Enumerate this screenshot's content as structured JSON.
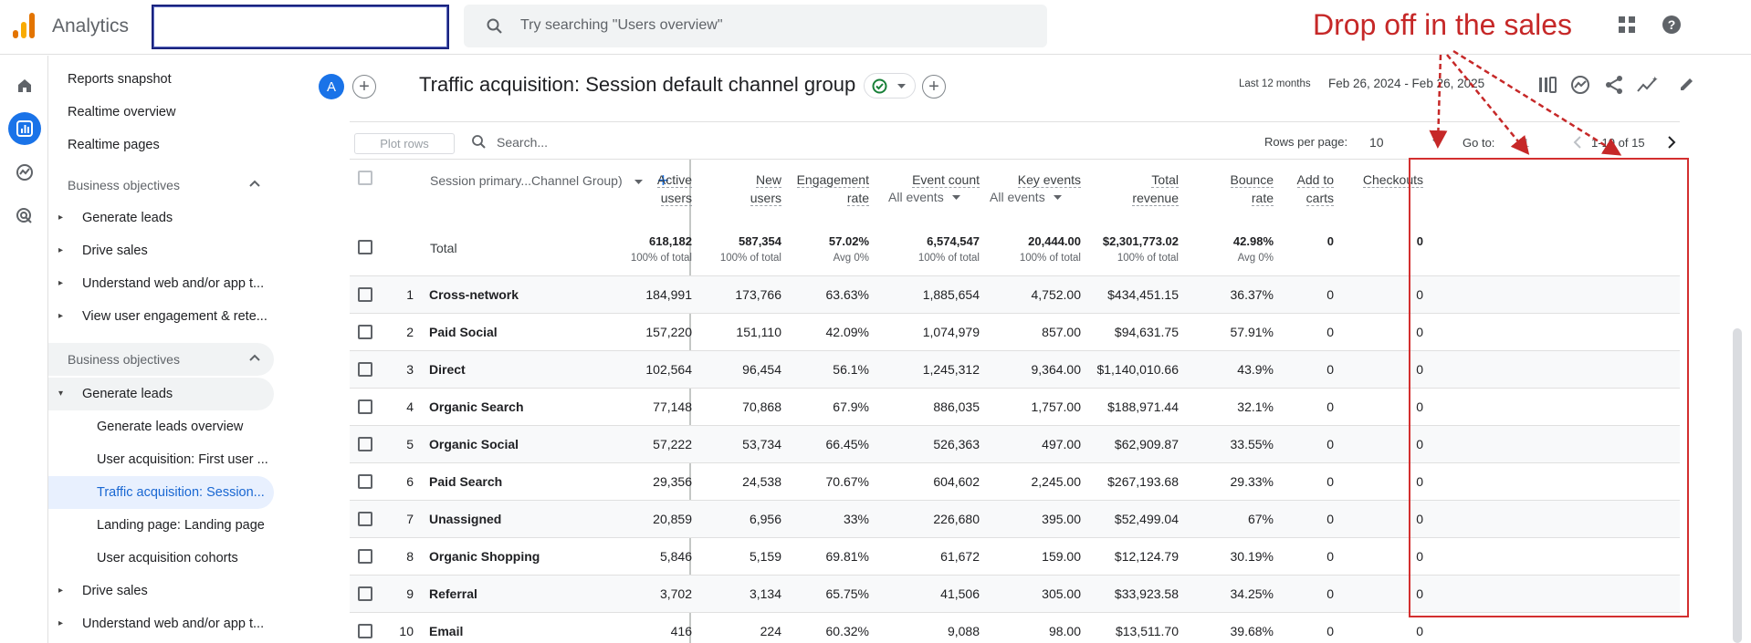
{
  "app": {
    "name": "Analytics"
  },
  "search": {
    "placeholder": "Try searching \"Users overview\""
  },
  "annotation": {
    "text": "Drop off in the sales",
    "color": "#c62828"
  },
  "colors": {
    "accent": "#1a73e8",
    "highlight_box": "#d32f2f",
    "selected_nav_bg": "#e8f0fe"
  },
  "sidebar": {
    "items": [
      {
        "label": "Reports snapshot",
        "type": "link"
      },
      {
        "label": "Realtime overview",
        "type": "link"
      },
      {
        "label": "Realtime pages",
        "type": "link"
      },
      {
        "label": "Business objectives",
        "type": "section",
        "expanded": true
      },
      {
        "label": "Generate leads",
        "type": "group"
      },
      {
        "label": "Drive sales",
        "type": "group"
      },
      {
        "label": "Understand web and/or app t...",
        "type": "group"
      },
      {
        "label": "View user engagement & rete...",
        "type": "group"
      },
      {
        "label": "Business objectives",
        "type": "section",
        "expanded": true
      },
      {
        "label": "Generate leads",
        "type": "group-open"
      },
      {
        "label": "Generate leads overview",
        "type": "sub"
      },
      {
        "label": "User acquisition: First user ...",
        "type": "sub"
      },
      {
        "label": "Traffic acquisition: Session...",
        "type": "sub-selected"
      },
      {
        "label": "Landing page: Landing page",
        "type": "sub"
      },
      {
        "label": "User acquisition cohorts",
        "type": "sub"
      },
      {
        "label": "Drive sales",
        "type": "group"
      },
      {
        "label": "Understand web and/or app t...",
        "type": "group"
      }
    ]
  },
  "report": {
    "avatar": "A",
    "title": "Traffic acquisition: Session default channel group",
    "date_label": "Last 12 months",
    "date_range": "Feb 26, 2024 - Feb 26, 2025"
  },
  "table": {
    "plot_rows": "Plot rows",
    "search_placeholder": "Search...",
    "rows_per_page_label": "Rows per page:",
    "rows_per_page": "10",
    "goto_label": "Go to:",
    "goto_value": "1",
    "page_info": "1-10 of 15",
    "dimension_header": "Session primary...Channel Group)",
    "columns": [
      {
        "line1": "Active",
        "line2": "users"
      },
      {
        "line1": "New",
        "line2": "users"
      },
      {
        "line1": "Engagement",
        "line2": "rate"
      },
      {
        "line1": "Event count",
        "sub": "All events"
      },
      {
        "line1": "Key events",
        "sub": "All events"
      },
      {
        "line1": "Total",
        "line2": "revenue"
      },
      {
        "line1": "Bounce",
        "line2": "rate"
      },
      {
        "line1": "Add to",
        "line2": "carts"
      },
      {
        "line1": "Checkouts"
      }
    ],
    "totals": {
      "label": "Total",
      "values": [
        "618,182",
        "587,354",
        "57.02%",
        "6,574,547",
        "20,444.00",
        "$2,301,773.02",
        "42.98%",
        "0",
        "0"
      ],
      "subs": [
        "100% of total",
        "100% of total",
        "Avg 0%",
        "100% of total",
        "100% of total",
        "100% of total",
        "Avg 0%",
        "",
        ""
      ]
    },
    "rows": [
      {
        "n": "1",
        "name": "Cross-network",
        "v": [
          "184,991",
          "173,766",
          "63.63%",
          "1,885,654",
          "4,752.00",
          "$434,451.15",
          "36.37%",
          "0",
          "0"
        ]
      },
      {
        "n": "2",
        "name": "Paid Social",
        "v": [
          "157,220",
          "151,110",
          "42.09%",
          "1,074,979",
          "857.00",
          "$94,631.75",
          "57.91%",
          "0",
          "0"
        ]
      },
      {
        "n": "3",
        "name": "Direct",
        "v": [
          "102,564",
          "96,454",
          "56.1%",
          "1,245,312",
          "9,364.00",
          "$1,140,010.66",
          "43.9%",
          "0",
          "0"
        ]
      },
      {
        "n": "4",
        "name": "Organic Search",
        "v": [
          "77,148",
          "70,868",
          "67.9%",
          "886,035",
          "1,757.00",
          "$188,971.44",
          "32.1%",
          "0",
          "0"
        ]
      },
      {
        "n": "5",
        "name": "Organic Social",
        "v": [
          "57,222",
          "53,734",
          "66.45%",
          "526,363",
          "497.00",
          "$62,909.87",
          "33.55%",
          "0",
          "0"
        ]
      },
      {
        "n": "6",
        "name": "Paid Search",
        "v": [
          "29,356",
          "24,538",
          "70.67%",
          "604,602",
          "2,245.00",
          "$267,193.68",
          "29.33%",
          "0",
          "0"
        ]
      },
      {
        "n": "7",
        "name": "Unassigned",
        "v": [
          "20,859",
          "6,956",
          "33%",
          "226,680",
          "395.00",
          "$52,499.04",
          "67%",
          "0",
          "0"
        ]
      },
      {
        "n": "8",
        "name": "Organic Shopping",
        "v": [
          "5,846",
          "5,159",
          "69.81%",
          "61,672",
          "159.00",
          "$12,124.79",
          "30.19%",
          "0",
          "0"
        ]
      },
      {
        "n": "9",
        "name": "Referral",
        "v": [
          "3,702",
          "3,134",
          "65.75%",
          "41,506",
          "305.00",
          "$33,923.58",
          "34.25%",
          "0",
          "0"
        ]
      },
      {
        "n": "10",
        "name": "Email",
        "v": [
          "416",
          "224",
          "60.32%",
          "9,088",
          "98.00",
          "$13,511.70",
          "39.68%",
          "0",
          "0"
        ]
      }
    ]
  }
}
